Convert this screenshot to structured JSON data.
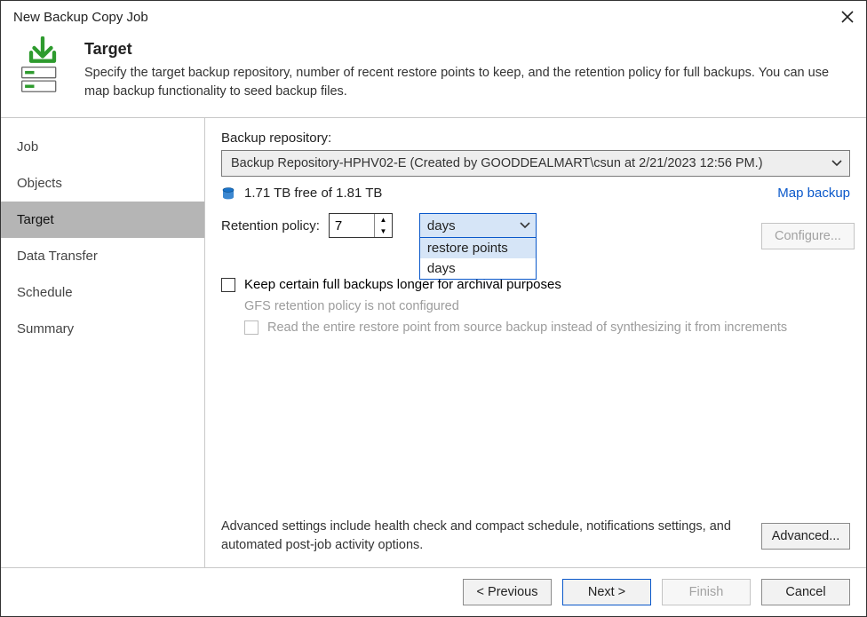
{
  "title": "New Backup Copy Job",
  "header": {
    "title": "Target",
    "subtitle": "Specify the target backup repository, number of recent restore points to keep, and the retention policy for full backups. You can use map backup functionality to seed backup files."
  },
  "sidebar": {
    "steps": [
      "Job",
      "Objects",
      "Target",
      "Data Transfer",
      "Schedule",
      "Summary"
    ],
    "active_index": 2
  },
  "content": {
    "repo_label": "Backup repository:",
    "repo_selected": "Backup Repository-HPHV02-E (Created by GOODDEALMART\\csun at 2/21/2023 12:56 PM.)",
    "free_space": "1.71 TB free of 1.81 TB",
    "map_link": "Map backup",
    "retention_label": "Retention policy:",
    "retention_value": "7",
    "retention_unit_selected": "days",
    "retention_unit_options": [
      "restore points",
      "days"
    ],
    "keep_full_label": "Keep certain full backups longer for archival purposes",
    "gfs_note": "GFS retention policy is not configured",
    "read_entire_label": "Read the entire restore point from source backup instead of synthesizing it from increments",
    "configure_label": "Configure...",
    "advanced_text": "Advanced settings include health check and compact schedule, notifications settings, and automated post-job activity options.",
    "advanced_label": "Advanced..."
  },
  "footer": {
    "previous": "< Previous",
    "next": "Next >",
    "finish": "Finish",
    "cancel": "Cancel"
  }
}
